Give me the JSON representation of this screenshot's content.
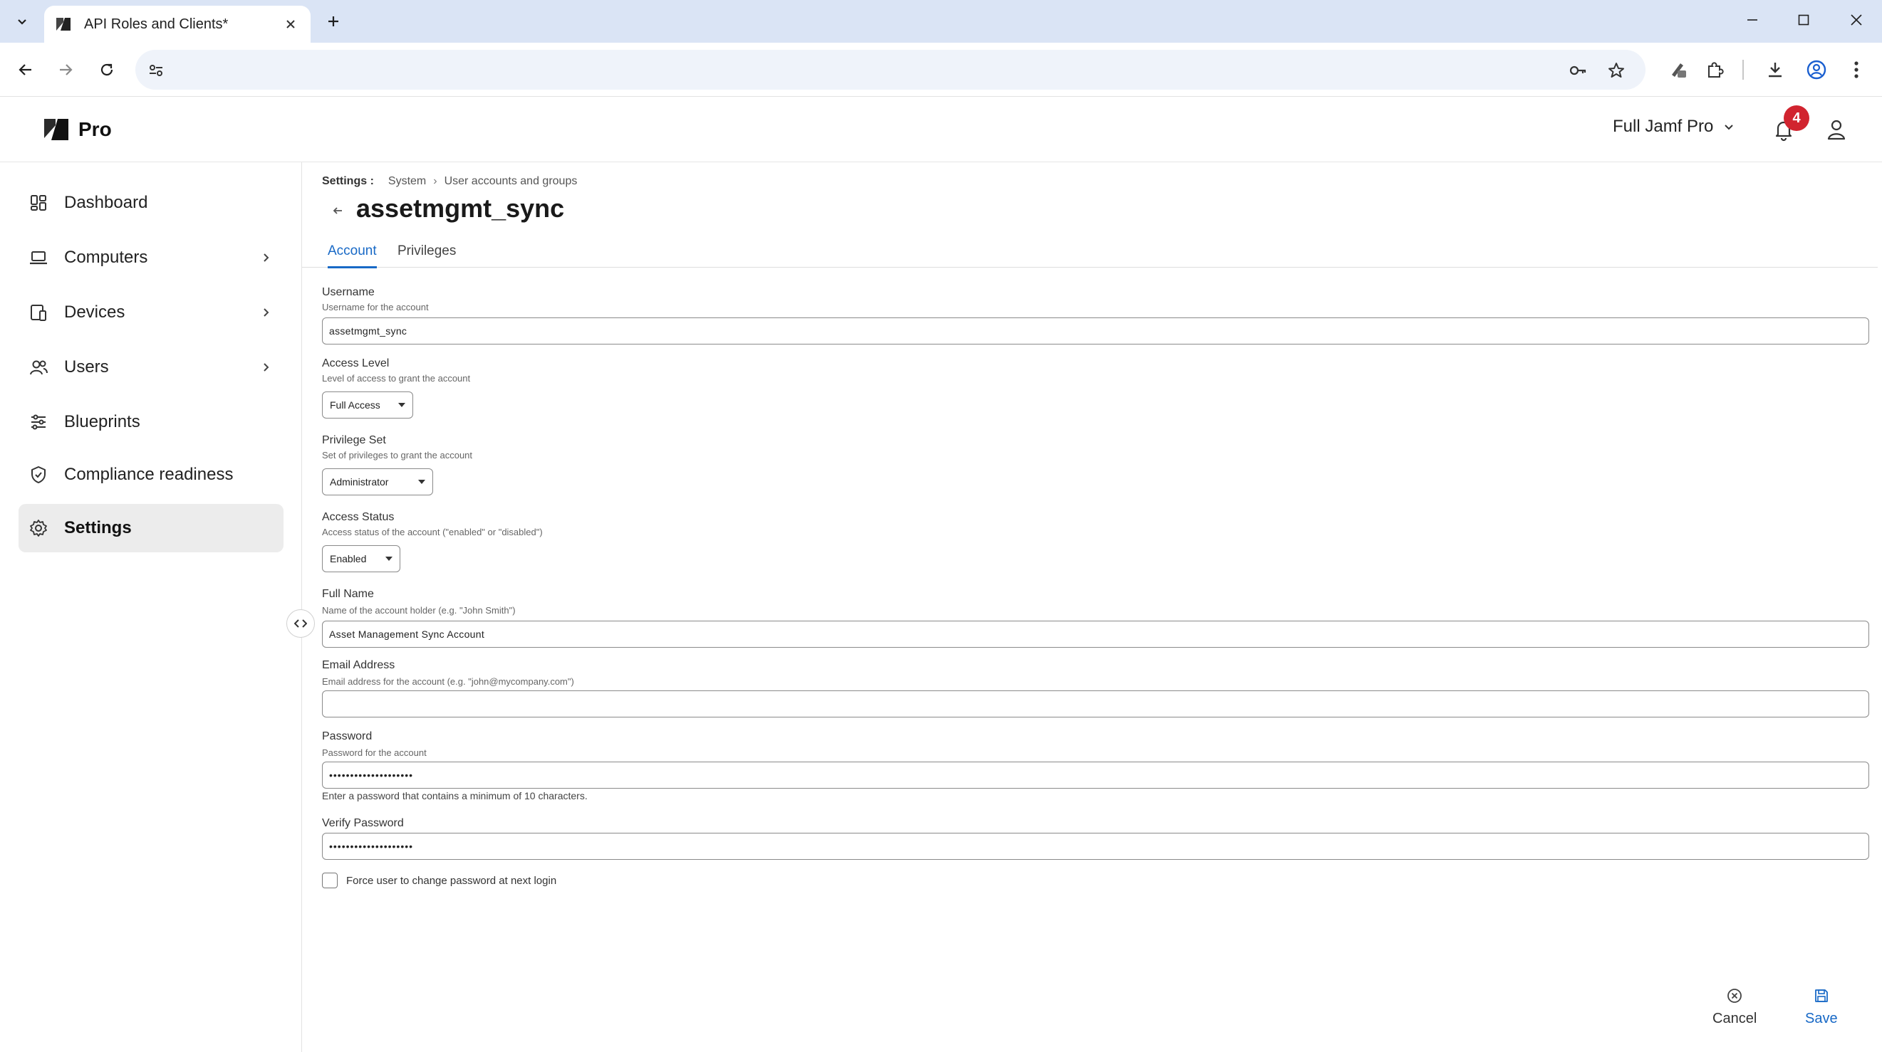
{
  "browser": {
    "tab_title": "API Roles and Clients*",
    "address": ""
  },
  "app": {
    "logo_text": "Pro",
    "environment": "Full Jamf Pro",
    "notification_count": "4"
  },
  "sidebar": {
    "items": [
      {
        "label": "Dashboard",
        "icon": "dashboard-icon",
        "has_chevron": false
      },
      {
        "label": "Computers",
        "icon": "laptop-icon",
        "has_chevron": true
      },
      {
        "label": "Devices",
        "icon": "devices-icon",
        "has_chevron": true
      },
      {
        "label": "Users",
        "icon": "users-icon",
        "has_chevron": true
      },
      {
        "label": "Blueprints",
        "icon": "sliders-icon",
        "has_chevron": false
      },
      {
        "label": "Compliance readiness",
        "icon": "shield-check-icon",
        "has_chevron": false
      },
      {
        "label": "Settings",
        "icon": "gear-icon",
        "has_chevron": false,
        "active": true
      }
    ]
  },
  "breadcrumb": {
    "root": "Settings :",
    "level1": "System",
    "level2": "User accounts and groups"
  },
  "page": {
    "title": "assetmgmt_sync",
    "tabs": [
      "Account",
      "Privileges"
    ],
    "active_tab": "Account"
  },
  "form": {
    "username": {
      "label": "Username",
      "help": "Username for the account",
      "value": "assetmgmt_sync"
    },
    "access_level": {
      "label": "Access Level",
      "help": "Level of access to grant the account",
      "value": "Full Access"
    },
    "privilege_set": {
      "label": "Privilege Set",
      "help": "Set of privileges to grant the account",
      "value": "Administrator"
    },
    "access_status": {
      "label": "Access Status",
      "help": "Access status of the account (\"enabled\" or \"disabled\")",
      "value": "Enabled"
    },
    "full_name": {
      "label": "Full Name",
      "help": "Name of the account holder (e.g. \"John Smith\")",
      "value": "Asset Management Sync Account"
    },
    "email": {
      "label": "Email Address",
      "help": "Email address for the account (e.g. \"john@mycompany.com\")",
      "value": ""
    },
    "password": {
      "label": "Password",
      "help": "Password for the account",
      "value": "••••••••••••••••••••",
      "hint": "Enter a password that contains a minimum of 10 characters."
    },
    "verify_password": {
      "label": "Verify Password",
      "value": "••••••••••••••••••••"
    },
    "force_change": {
      "label": "Force user to change password at next login",
      "checked": false
    }
  },
  "actions": {
    "cancel": "Cancel",
    "save": "Save"
  },
  "colors": {
    "accent": "#1869c6",
    "badge": "#d1242f",
    "tabbar": "#dae4f5"
  }
}
